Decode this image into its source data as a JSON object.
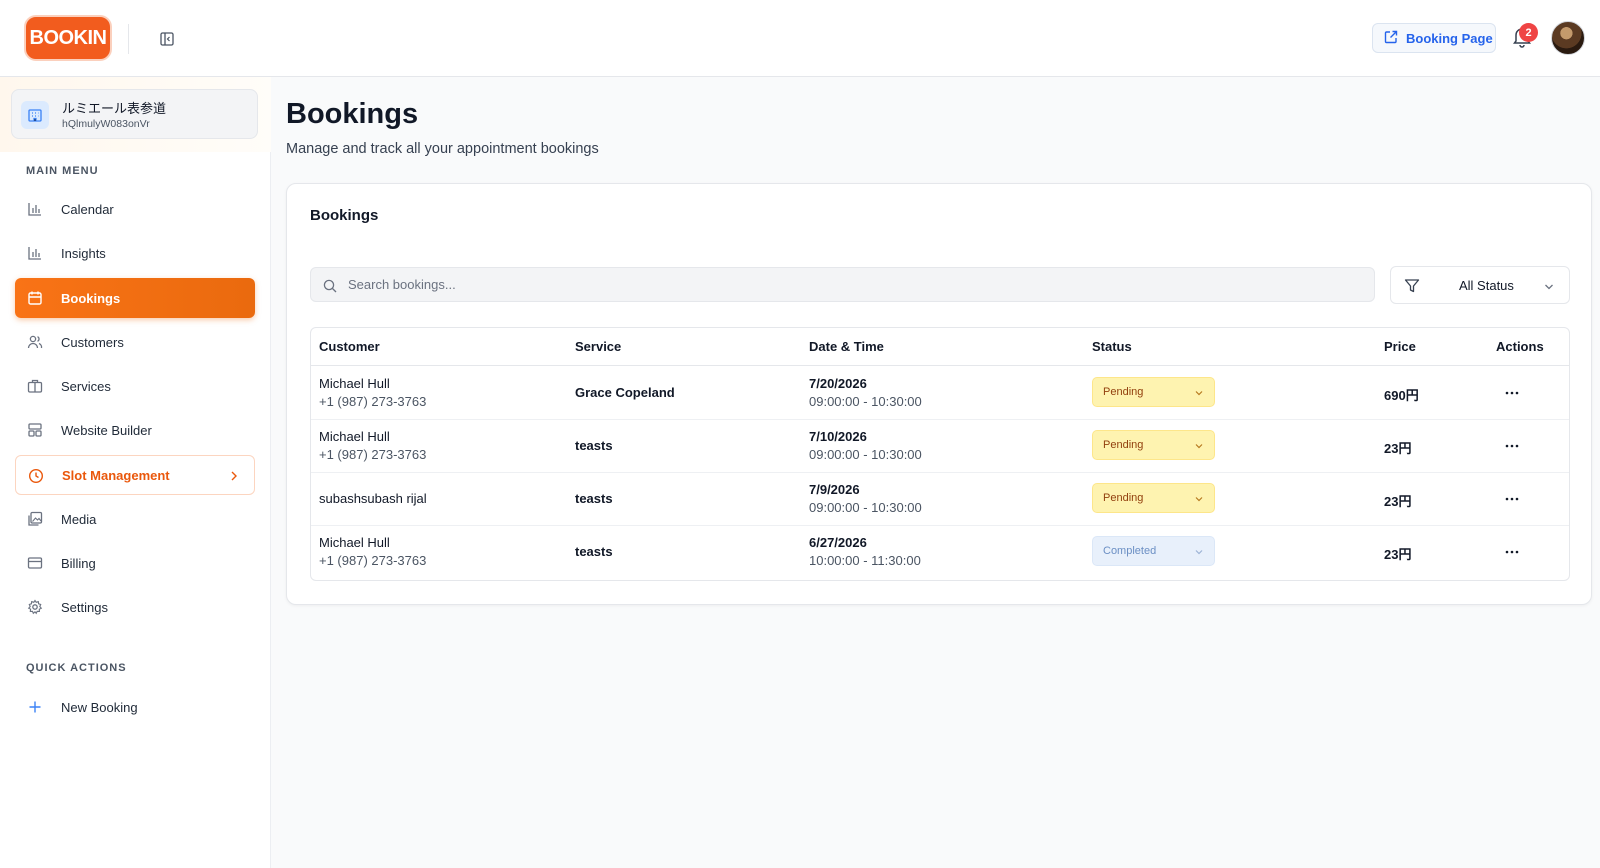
{
  "header": {
    "logo_text": "BOOKIN",
    "booking_page_label": "Booking Page",
    "notification_count": "2",
    "icons": [
      "collapse-sidebar-icon",
      "external-link-icon",
      "bell-icon",
      "avatar"
    ]
  },
  "sidebar": {
    "org": {
      "name": "ルミエール表参道",
      "id": "hQlmulyW083onVr"
    },
    "main_menu_label": "MAIN MENU",
    "items": [
      {
        "label": "Calendar",
        "icon": "bar-chart-icon"
      },
      {
        "label": "Insights",
        "icon": "bar-chart-icon"
      },
      {
        "label": "Bookings",
        "icon": "calendar-icon",
        "active": true
      },
      {
        "label": "Customers",
        "icon": "users-icon"
      },
      {
        "label": "Services",
        "icon": "briefcase-icon"
      },
      {
        "label": "Website Builder",
        "icon": "layout-icon"
      },
      {
        "label": "Slot Management",
        "icon": "clock-icon",
        "expandable": true
      },
      {
        "label": "Media",
        "icon": "images-icon"
      },
      {
        "label": "Billing",
        "icon": "credit-card-icon"
      },
      {
        "label": "Settings",
        "icon": "gear-icon"
      }
    ],
    "quick_actions_label": "QUICK ACTIONS",
    "quick_actions": [
      {
        "label": "New Booking",
        "icon": "plus-icon"
      }
    ]
  },
  "page": {
    "title": "Bookings",
    "subtitle": "Manage and track all your appointment bookings"
  },
  "bookings_card": {
    "title": "Bookings",
    "search_placeholder": "Search bookings...",
    "status_filter": "All Status",
    "columns": [
      "Customer",
      "Service",
      "Date & Time",
      "Status",
      "Price",
      "Actions"
    ],
    "rows": [
      {
        "customer": "Michael Hull",
        "phone": "+1 (987) 273-3763",
        "service": "Grace Copeland",
        "date": "7/20/2026",
        "time": "09:00:00 - 10:30:00",
        "status": "Pending",
        "price": "690円"
      },
      {
        "customer": "Michael Hull",
        "phone": "+1 (987) 273-3763",
        "service": "teasts",
        "date": "7/10/2026",
        "time": "09:00:00 - 10:30:00",
        "status": "Pending",
        "price": "23円"
      },
      {
        "customer": "subashsubash rijal",
        "phone": "",
        "service": "teasts",
        "date": "7/9/2026",
        "time": "09:00:00 - 10:30:00",
        "status": "Pending",
        "price": "23円"
      },
      {
        "customer": "Michael Hull",
        "phone": "+1 (987) 273-3763",
        "service": "teasts",
        "date": "6/27/2026",
        "time": "10:00:00 - 11:30:00",
        "status": "Completed",
        "price": "23円"
      }
    ]
  },
  "colors": {
    "brand": "#f25c1e",
    "active_nav": "#f97316",
    "link": "#2563eb",
    "pending_bg": "#fef3b0",
    "completed_bg": "#e8f0fb",
    "badge": "#ef4444"
  }
}
